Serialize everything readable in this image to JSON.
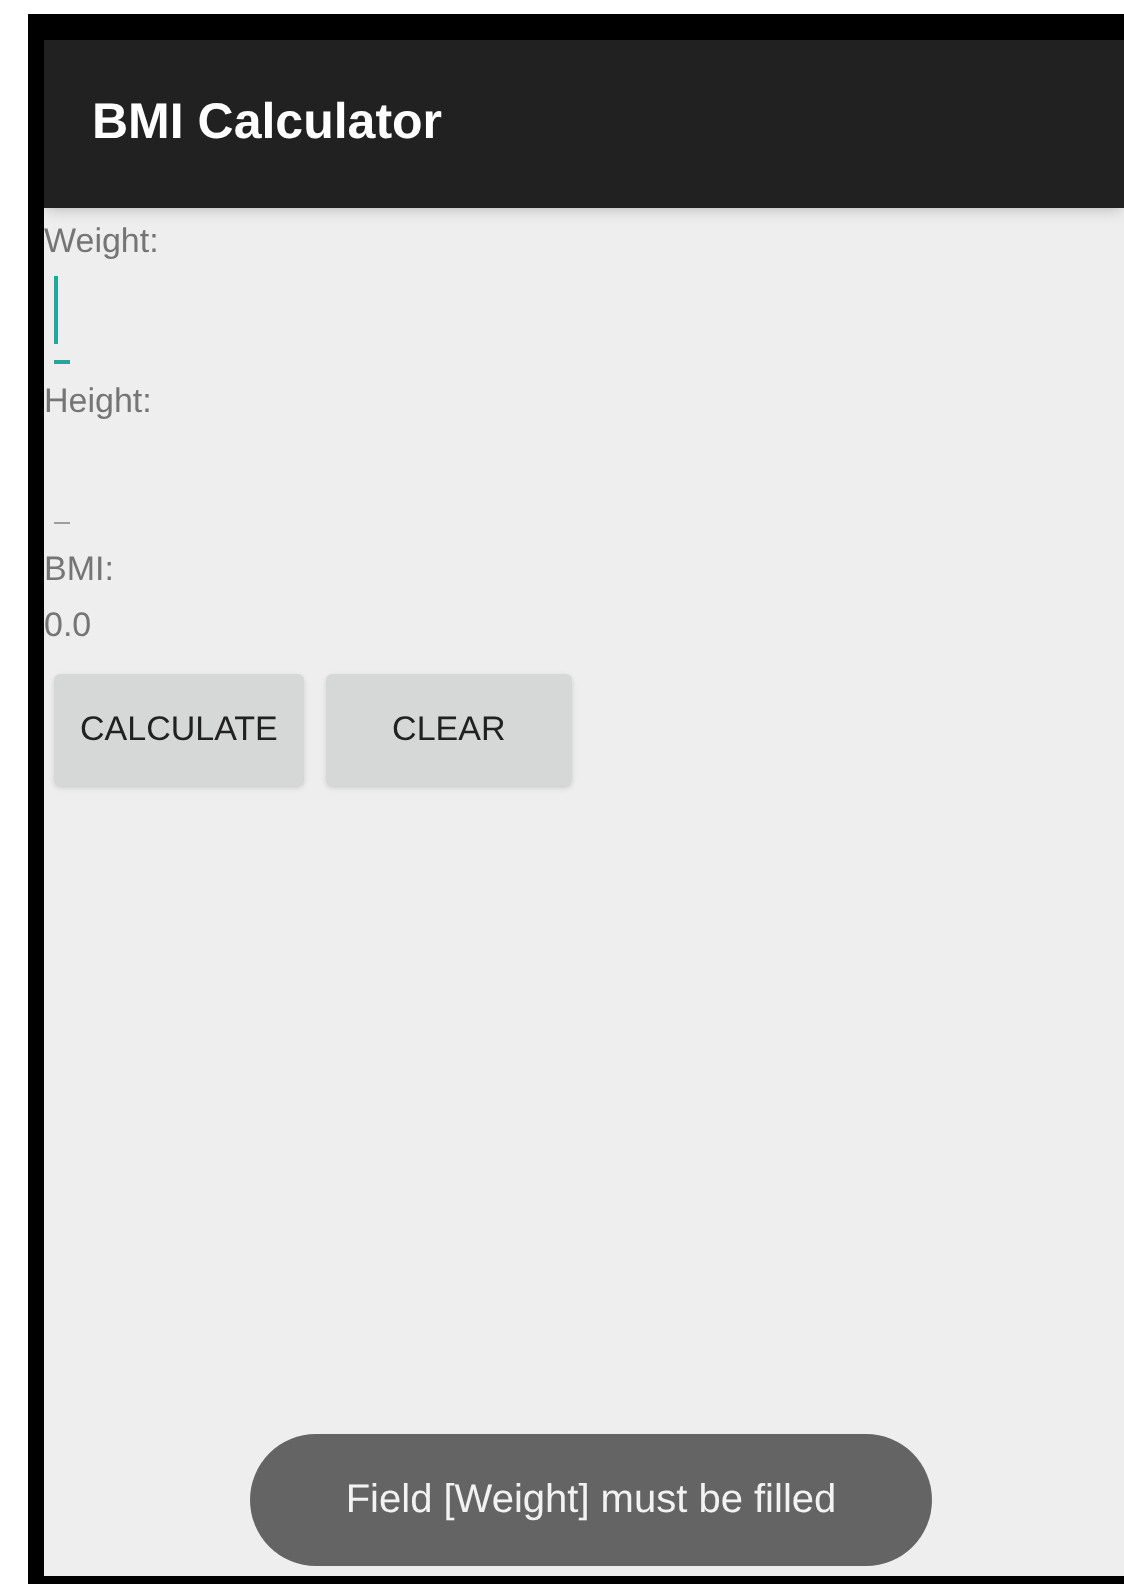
{
  "app_bar": {
    "title": "BMI Calculator"
  },
  "fields": [
    {
      "label": "Weight:",
      "focused": true
    },
    {
      "label": "Height:",
      "focused": false
    }
  ],
  "result": {
    "label": "BMI:",
    "value": "0.0"
  },
  "buttons": [
    "CALCULATE",
    "CLEAR"
  ],
  "toast": {
    "message": "Field [Weight] must be filled"
  }
}
